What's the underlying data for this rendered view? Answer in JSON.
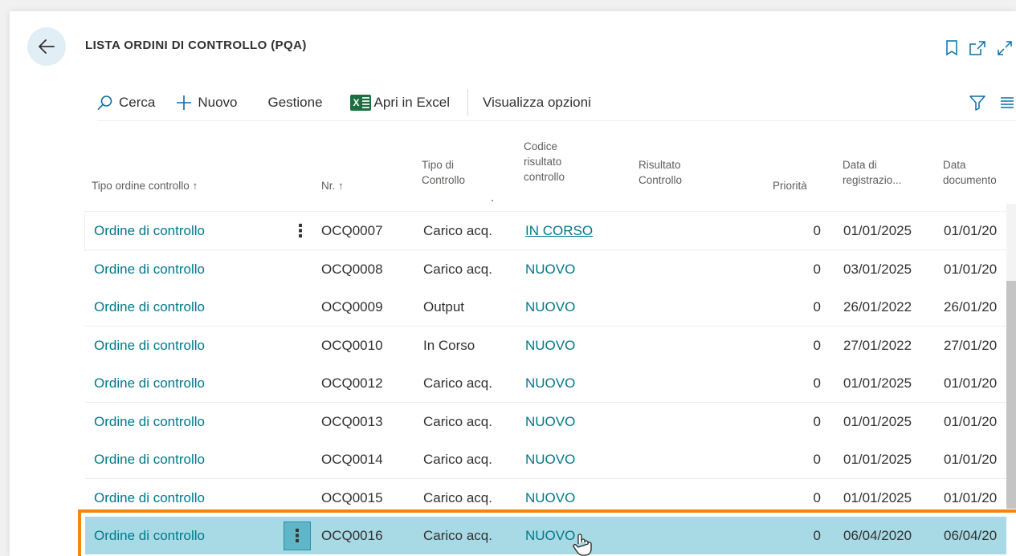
{
  "header": {
    "title": "LISTA ORDINI DI CONTROLLO (PQA)",
    "icons": [
      "back-arrow-icon",
      "bookmark-icon",
      "open-new-window-icon",
      "expand-icon"
    ]
  },
  "toolbar": {
    "search_label": "Cerca",
    "new_label": "Nuovo",
    "manage_label": "Gestione",
    "excel_label": "Apri in Excel",
    "view_options_label": "Visualizza opzioni"
  },
  "table": {
    "columns": [
      {
        "key": "tipo",
        "label": "Tipo ordine controllo ↑"
      },
      {
        "key": "nr",
        "label": "Nr. ↑"
      },
      {
        "key": "tipo_controllo",
        "label_1": "Tipo di",
        "label_2": "Controllo"
      },
      {
        "key": "codice",
        "label_1": "Codice",
        "label_2": "risultato",
        "label_3": "controllo"
      },
      {
        "key": "risultato",
        "label_1": "Risultato",
        "label_2": "Controllo"
      },
      {
        "key": "priorita",
        "label": "Priorità"
      },
      {
        "key": "data_reg",
        "label_1": "Data di",
        "label_2": "registrazio..."
      },
      {
        "key": "data_doc",
        "label_1": "Data",
        "label_2": "documento"
      }
    ],
    "rows": [
      {
        "tipo": "Ordine di controllo",
        "nr": "OCQ0007",
        "tipo_controllo": "Carico acq.",
        "codice": "IN CORSO",
        "risultato": "",
        "priorita": "0",
        "data_reg": "01/01/2025",
        "data_doc": "01/01/20"
      },
      {
        "tipo": "Ordine di controllo",
        "nr": "OCQ0008",
        "tipo_controllo": "Carico acq.",
        "codice": "NUOVO",
        "risultato": "",
        "priorita": "0",
        "data_reg": "03/01/2025",
        "data_doc": "01/01/20"
      },
      {
        "tipo": "Ordine di controllo",
        "nr": "OCQ0009",
        "tipo_controllo": "Output",
        "codice": "NUOVO",
        "risultato": "",
        "priorita": "0",
        "data_reg": "26/01/2022",
        "data_doc": "26/01/20"
      },
      {
        "tipo": "Ordine di controllo",
        "nr": "OCQ0010",
        "tipo_controllo": "In Corso",
        "codice": "NUOVO",
        "risultato": "",
        "priorita": "0",
        "data_reg": "27/01/2022",
        "data_doc": "27/01/20"
      },
      {
        "tipo": "Ordine di controllo",
        "nr": "OCQ0012",
        "tipo_controllo": "Carico acq.",
        "codice": "NUOVO",
        "risultato": "",
        "priorita": "0",
        "data_reg": "01/01/2025",
        "data_doc": "01/01/20"
      },
      {
        "tipo": "Ordine di controllo",
        "nr": "OCQ0013",
        "tipo_controllo": "Carico acq.",
        "codice": "NUOVO",
        "risultato": "",
        "priorita": "0",
        "data_reg": "01/01/2025",
        "data_doc": "01/01/20"
      },
      {
        "tipo": "Ordine di controllo",
        "nr": "OCQ0014",
        "tipo_controllo": "Carico acq.",
        "codice": "NUOVO",
        "risultato": "",
        "priorita": "0",
        "data_reg": "01/01/2025",
        "data_doc": "01/01/20"
      },
      {
        "tipo": "Ordine di controllo",
        "nr": "OCQ0015",
        "tipo_controllo": "Carico acq.",
        "codice": "NUOVO",
        "risultato": "",
        "priorita": "0",
        "data_reg": "01/01/2025",
        "data_doc": "01/01/20"
      },
      {
        "tipo": "Ordine di controllo",
        "nr": "OCQ0016",
        "tipo_controllo": "Carico acq.",
        "codice": "NUOVO",
        "risultato": "",
        "priorita": "0",
        "data_reg": "06/04/2020",
        "data_doc": "06/04/20"
      }
    ],
    "row_menu_symbol": "⋮"
  },
  "colors": {
    "link": "#00788a",
    "selected_row": "#a8dae6",
    "highlight_frame": "#f0870e",
    "excel_green": "#1d6f42",
    "accent_blue": "#0a6fa6"
  }
}
